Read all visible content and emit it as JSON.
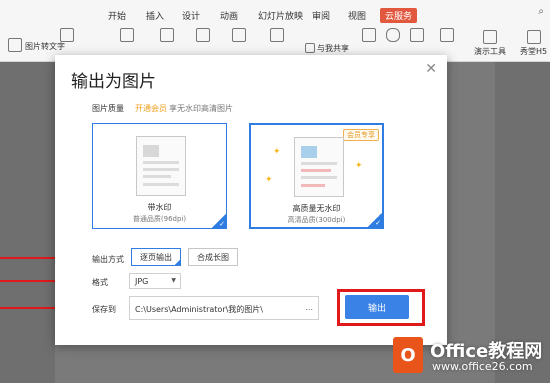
{
  "ribbon": {
    "tabs": [
      "开始",
      "插入",
      "设计",
      "动画",
      "幻灯片放映",
      "审阅",
      "视图",
      "云服务"
    ],
    "active_tab": "云服务",
    "active_color": "#e2583e",
    "tools": [
      "图片转文字",
      "与我共享",
      "演示工具",
      "秀堂H5"
    ]
  },
  "dialog": {
    "title": "输出为图片",
    "quality_label": "图片质量",
    "vip_link": "开通会员",
    "vip_note": "享无水印高清图片",
    "cards": [
      {
        "name": "带水印",
        "sub": "普通品质(96dpi)"
      },
      {
        "name": "高质量无水印",
        "sub": "高清品质(300dpi)",
        "badge": "会员专享"
      }
    ],
    "output_mode_label": "输出方式",
    "output_modes": [
      "逐页输出",
      "合成长图"
    ],
    "format_label": "格式",
    "format_value": "JPG",
    "save_label": "保存到",
    "save_path": "C:\\Users\\Administrator\\我的图片\\",
    "browse": "...",
    "export_button": "输出",
    "accent_color": "#2f7de1",
    "highlight_color": "#e01a1a"
  },
  "watermark": {
    "title": "Office教程网",
    "url": "www.office26.com"
  }
}
